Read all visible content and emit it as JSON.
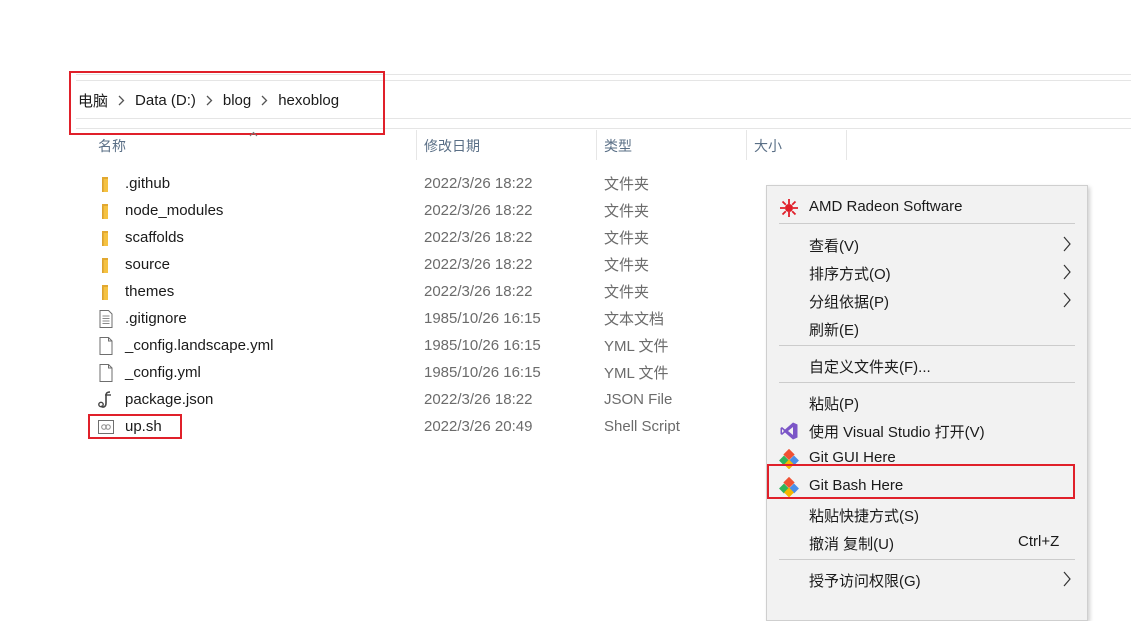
{
  "address_bar": {
    "breadcrumbs": [
      "电脑",
      "Data (D:)",
      "blog",
      "hexoblog"
    ]
  },
  "columns": {
    "name": "名称",
    "modified": "修改日期",
    "type": "类型",
    "size": "大小"
  },
  "files": [
    {
      "name": ".github",
      "modified": "2022/3/26 18:22",
      "type": "文件夹",
      "icon": "folder-icon"
    },
    {
      "name": "node_modules",
      "modified": "2022/3/26 18:22",
      "type": "文件夹",
      "icon": "folder-icon"
    },
    {
      "name": "scaffolds",
      "modified": "2022/3/26 18:22",
      "type": "文件夹",
      "icon": "folder-icon"
    },
    {
      "name": "source",
      "modified": "2022/3/26 18:22",
      "type": "文件夹",
      "icon": "folder-icon"
    },
    {
      "name": "themes",
      "modified": "2022/3/26 18:22",
      "type": "文件夹",
      "icon": "folder-icon"
    },
    {
      "name": ".gitignore",
      "modified": "1985/10/26 16:15",
      "type": "文本文档",
      "icon": "text-file-icon"
    },
    {
      "name": "_config.landscape.yml",
      "modified": "1985/10/26 16:15",
      "type": "YML 文件",
      "icon": "file-icon"
    },
    {
      "name": "_config.yml",
      "modified": "1985/10/26 16:15",
      "type": "YML 文件",
      "icon": "file-icon"
    },
    {
      "name": "package.json",
      "modified": "2022/3/26 18:22",
      "type": "JSON File",
      "icon": "json-file-icon"
    },
    {
      "name": "up.sh",
      "modified": "2022/3/26 20:49",
      "type": "Shell Script",
      "icon": "shell-script-icon"
    }
  ],
  "context_menu": {
    "items": [
      {
        "label": "AMD Radeon Software",
        "icon": "amd-radeon-icon"
      },
      {
        "label": "查看(V)",
        "submenu": true
      },
      {
        "label": "排序方式(O)",
        "submenu": true
      },
      {
        "label": "分组依据(P)",
        "submenu": true
      },
      {
        "label": "刷新(E)"
      },
      {
        "label": "自定义文件夹(F)..."
      },
      {
        "label": "粘贴(P)"
      },
      {
        "label": "使用 Visual Studio 打开(V)",
        "icon": "visual-studio-icon"
      },
      {
        "label": "Git GUI Here",
        "icon": "git-icon"
      },
      {
        "label": "Git Bash Here",
        "icon": "git-icon"
      },
      {
        "label": "粘贴快捷方式(S)"
      },
      {
        "label": "撤消 复制(U)",
        "shortcut": "Ctrl+Z"
      },
      {
        "label": "授予访问权限(G)",
        "submenu": true
      }
    ]
  },
  "colors": {
    "highlight_red": "#e0202a",
    "folder_yellow": "#f5c242",
    "header_text": "#5a6f86",
    "menu_bg": "#f2f2f2"
  }
}
